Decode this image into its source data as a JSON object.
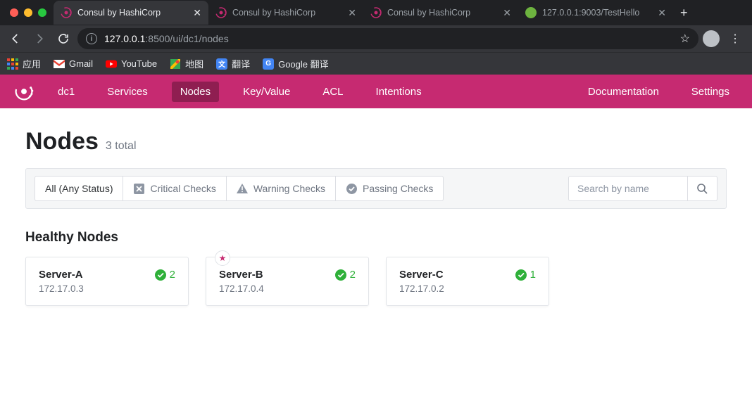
{
  "browser": {
    "tabs": [
      {
        "title": "Consul by HashiCorp",
        "favicon": "consul",
        "active": true
      },
      {
        "title": "Consul by HashiCorp",
        "favicon": "consul",
        "active": false
      },
      {
        "title": "Consul by HashiCorp",
        "favicon": "consul",
        "active": false
      },
      {
        "title": "127.0.0.1:9003/TestHello",
        "favicon": "spring",
        "active": false
      }
    ],
    "url_host": "127.0.0.1",
    "url_rest": ":8500/ui/dc1/nodes",
    "bookmarks": [
      {
        "label": "应用",
        "icon": "apps"
      },
      {
        "label": "Gmail",
        "icon": "gmail"
      },
      {
        "label": "YouTube",
        "icon": "youtube"
      },
      {
        "label": "地图",
        "icon": "maps"
      },
      {
        "label": "翻译",
        "icon": "translate"
      },
      {
        "label": "Google 翻译",
        "icon": "translate"
      }
    ]
  },
  "nav": {
    "datacenter": "dc1",
    "items": [
      "Services",
      "Nodes",
      "Key/Value",
      "ACL",
      "Intentions"
    ],
    "active": "Nodes",
    "right": [
      "Documentation",
      "Settings"
    ]
  },
  "page": {
    "title": "Nodes",
    "count_label": "3 total",
    "filters": {
      "all": "All (Any Status)",
      "critical": "Critical Checks",
      "warning": "Warning Checks",
      "passing": "Passing Checks"
    },
    "search_placeholder": "Search by name",
    "section_title": "Healthy Nodes",
    "nodes": [
      {
        "name": "Server-A",
        "ip": "172.17.0.3",
        "checks": "2",
        "leader": false
      },
      {
        "name": "Server-B",
        "ip": "172.17.0.4",
        "checks": "2",
        "leader": true
      },
      {
        "name": "Server-C",
        "ip": "172.17.0.2",
        "checks": "1",
        "leader": false
      }
    ]
  }
}
